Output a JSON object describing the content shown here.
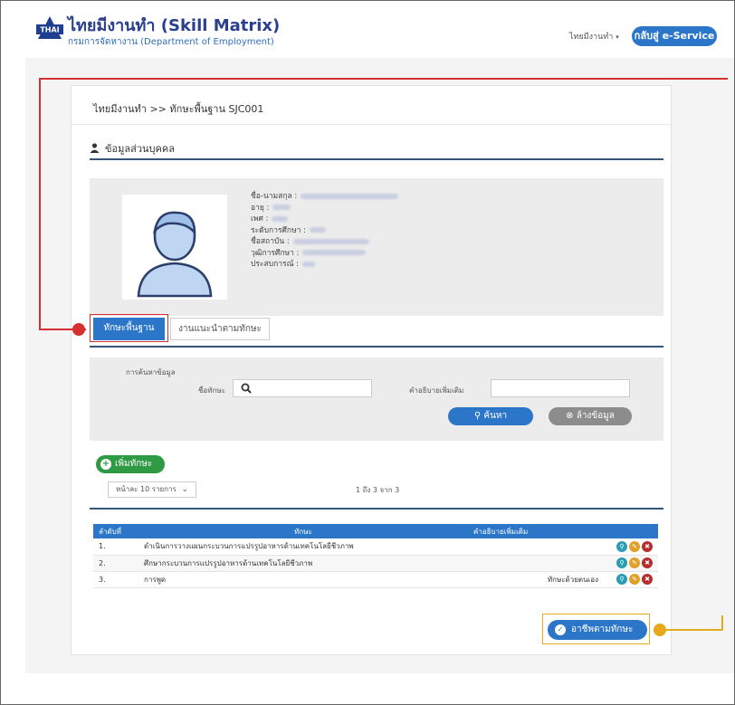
{
  "header": {
    "logo_text": "THAI",
    "title": "ไทยมีงานทำ (Skill Matrix)",
    "subtitle": "กรมการจัดหางาน (Department of Employment)",
    "user_menu": "ไทยมีงานทำ",
    "eservice_button": "กลับสู่ e-Service"
  },
  "breadcrumb": "ไทยมีงานทำ >> ทักษะพื้นฐาน SJC001",
  "profile": {
    "section_title": "ข้อมูลส่วนบุคคล",
    "fields": [
      {
        "label": "ชื่อ-นามสกุล :"
      },
      {
        "label": "อายุ :"
      },
      {
        "label": "เพศ :"
      },
      {
        "label": "ระดับการศึกษา :"
      },
      {
        "label": "ชื่อสถาบัน :"
      },
      {
        "label": "วุฒิการศึกษา :"
      },
      {
        "label": "ประสบการณ์ :"
      }
    ]
  },
  "tabs": {
    "basic_skills": "ทักษะพื้นฐาน",
    "recommended_jobs": "งานแนะนำตามทักษะ"
  },
  "search": {
    "legend": "การค้นหาข้อมูล",
    "skill_name_label": "ชื่อทักษะ",
    "description_label": "คำอธิบายเพิ่มเติม",
    "search_button": "ค้นหา",
    "clear_button": "ล้างข้อมูล"
  },
  "add_skill_button": "เพิ่มทักษะ",
  "pagination": {
    "page_size": "หน้าละ 10 รายการ",
    "range_text": "1 ถึง 3 จาก 3"
  },
  "table": {
    "headers": [
      "ลำดับที่",
      "ทักษะ",
      "คำอธิบายเพิ่มเติม"
    ],
    "rows": [
      {
        "no": "1.",
        "skill": "ดำเนินการวางแผนกระบวนการแปรรูปอาหารด้านเทคโนโลยีชีวภาพ",
        "description": ""
      },
      {
        "no": "2.",
        "skill": "ศึกษากระบวนการแปรรูปอาหารด้านเทคโนโลยีชีวภาพ",
        "description": ""
      },
      {
        "no": "3.",
        "skill": "การพูด",
        "description": "ทักษะด้วยตนเอง"
      }
    ]
  },
  "career_button": "อาชีพตามทักษะ",
  "colors": {
    "primary": "#2c76c9",
    "add_green": "#2f9a44",
    "callout_red": "#d62f2f",
    "callout_yellow": "#e6a91c"
  }
}
